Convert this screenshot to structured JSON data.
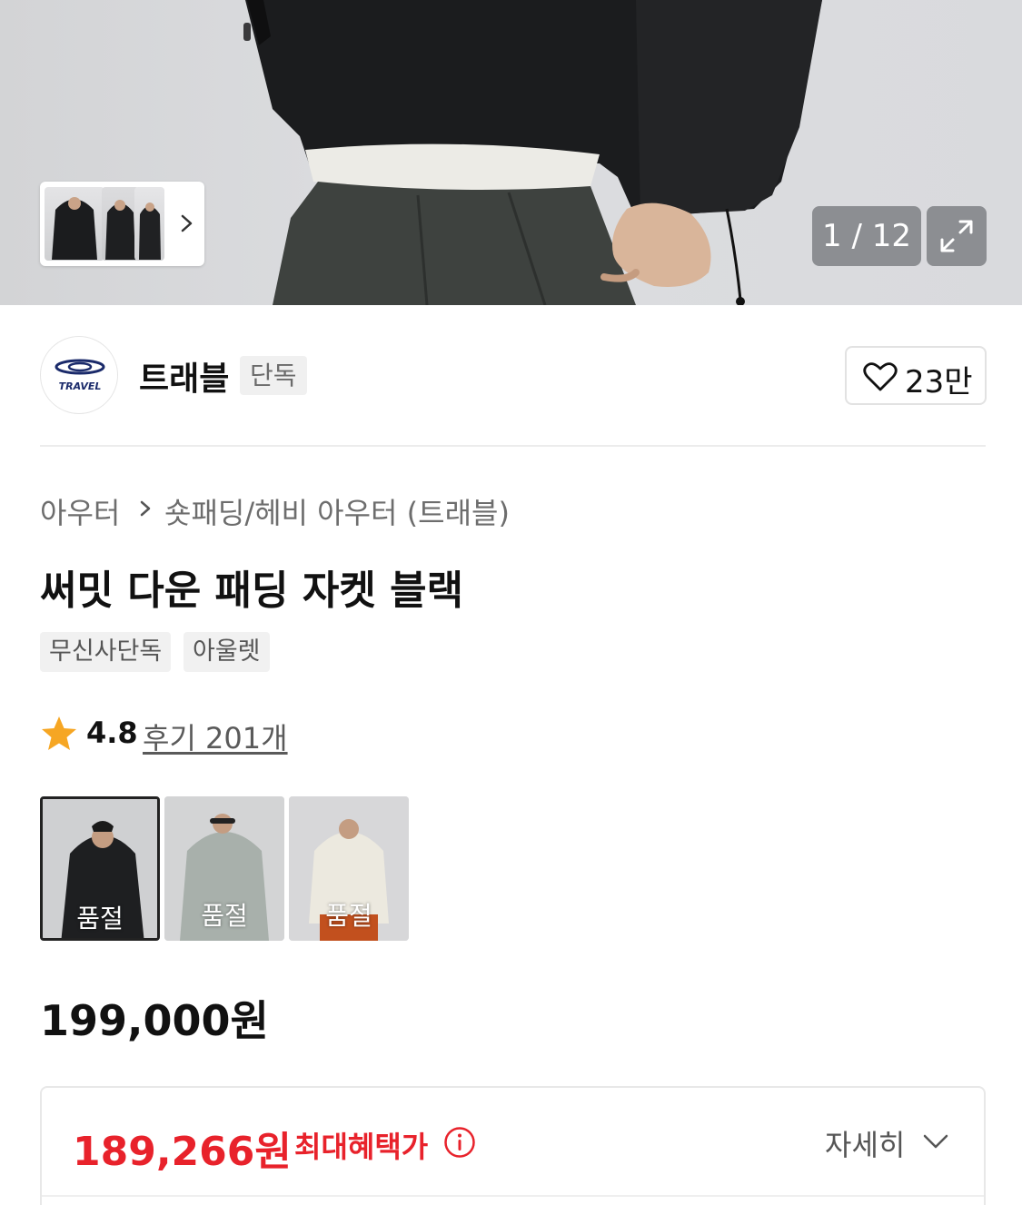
{
  "gallery": {
    "counter": "1 / 12",
    "expand_icon": "expand-icon",
    "next_icon": "chevron-right-icon"
  },
  "brand": {
    "logo_text": "TRAVEL",
    "name": "트래블",
    "badge": "단독",
    "like_count": "23만"
  },
  "category": {
    "level1": "아우터",
    "level2": "숏패딩/헤비 아우터 (트래블)"
  },
  "product": {
    "title": "써밋 다운 패딩 자켓 블랙",
    "tags": [
      "무신사단독",
      "아울렛"
    ]
  },
  "rating": {
    "score": "4.8",
    "reviews": "후기 201개",
    "star_color": "#f6a623"
  },
  "swatches": [
    {
      "status": "품절",
      "color": "#1e1f21"
    },
    {
      "status": "품절",
      "color": "#a8b0ab"
    },
    {
      "status": "품절",
      "color": "#ece9df"
    }
  ],
  "price": {
    "original": "199,000원"
  },
  "benefit": {
    "price": "189,266원",
    "label": "최대혜택가",
    "detail_label": "자세히",
    "accent_color": "#e8222b"
  }
}
